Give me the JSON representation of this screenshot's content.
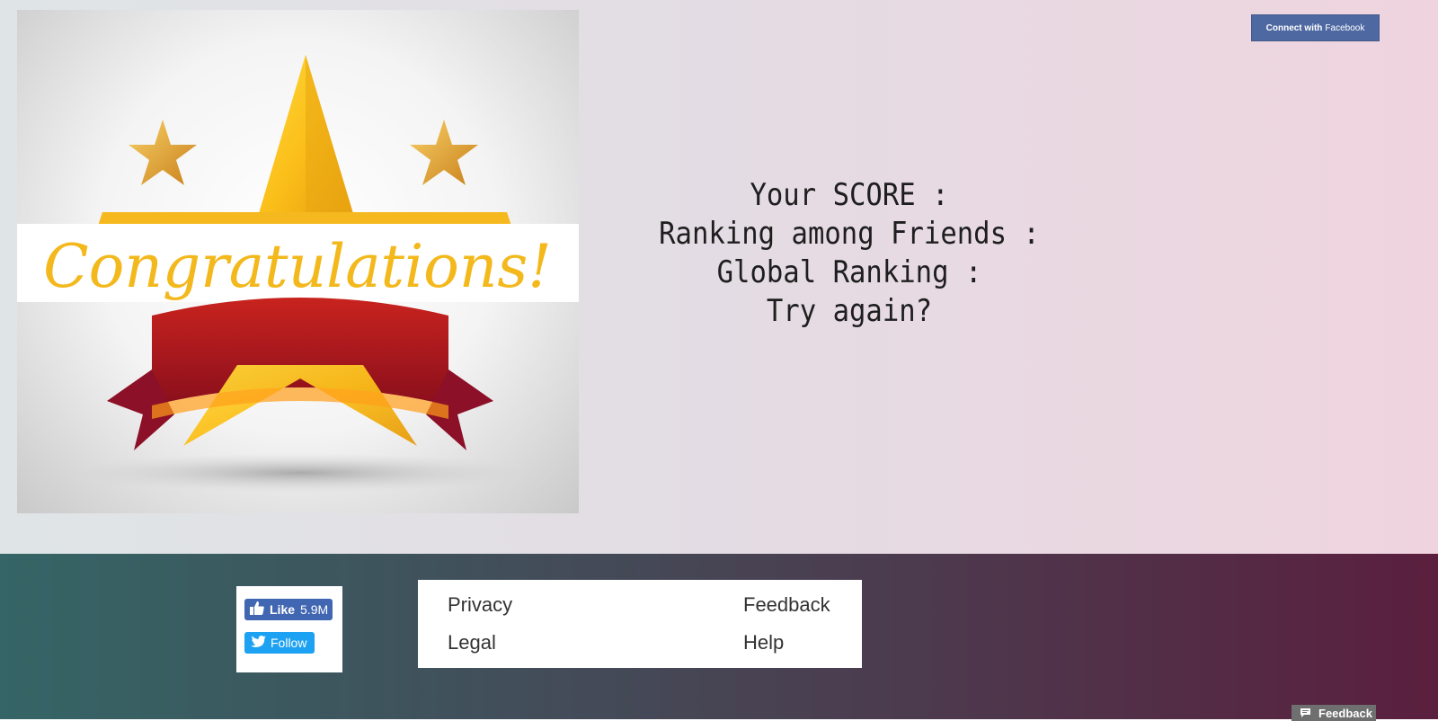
{
  "header": {
    "connect_label_bold": "Connect with",
    "connect_label_brand": "Facebook"
  },
  "banner": {
    "headline": "Congratulations!",
    "star_icon": "star-icon",
    "ribbon_icon": "ribbon-icon"
  },
  "results": {
    "score_label": "Your SCORE :",
    "friends_rank_label": "Ranking among Friends :",
    "global_rank_label": "Global Ranking :",
    "try_again": "Try again?"
  },
  "social": {
    "like_label": "Like",
    "like_count": "5.9M",
    "follow_label": "Follow"
  },
  "footer_links": {
    "privacy": "Privacy",
    "legal": "Legal",
    "feedback": "Feedback",
    "help": "Help"
  },
  "feedback_tab": {
    "label": "Feedback"
  },
  "colors": {
    "facebook_blue": "#4267b2",
    "twitter_blue": "#1da1f2",
    "footer_start": "#356566",
    "footer_end": "#5a1f3e"
  }
}
